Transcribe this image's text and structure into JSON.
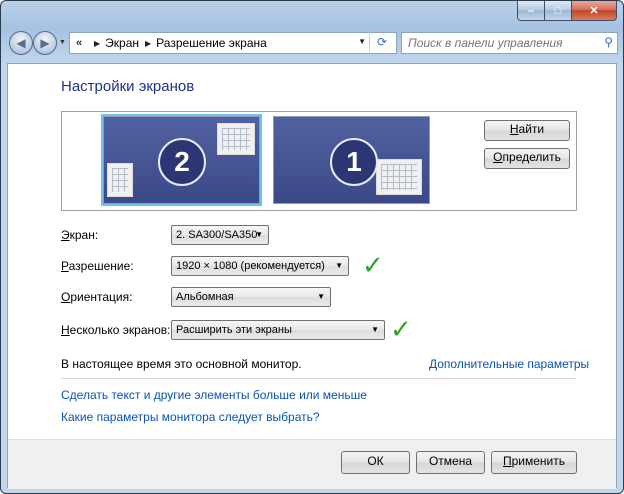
{
  "window": {
    "caption_buttons": {
      "minimize": "‒",
      "maximize": "□",
      "close": "✕"
    }
  },
  "nav": {
    "back_icon": "back-arrow-icon",
    "forward_icon": "forward-arrow-icon",
    "address_overflow": "«",
    "breadcrumb": [
      "Экран",
      "Разрешение экрана"
    ],
    "search_placeholder": "Поиск в панели управления"
  },
  "main": {
    "title": "Настройки экранов",
    "monitors": [
      {
        "number": "2",
        "selected": true
      },
      {
        "number": "1",
        "selected": false
      }
    ],
    "find_button": {
      "underlined": "Н",
      "rest": "айти"
    },
    "identify_button": {
      "underlined": "О",
      "rest": "пределить"
    },
    "fields": [
      {
        "label_underlined": "Э",
        "label_rest": "кран:",
        "value": "2. SA300/SA350",
        "checked": false
      },
      {
        "label_underlined": "Р",
        "label_rest": "азрешение:",
        "value": "1920 × 1080 (рекомендуется)",
        "checked": true
      },
      {
        "label_underlined": "О",
        "label_rest": "риентация:",
        "value": "Альбомная",
        "checked": false
      },
      {
        "label_underlined": "Н",
        "label_rest": "есколько экранов:",
        "value": "Расширить эти экраны",
        "checked": true
      }
    ],
    "status_text": "В настоящее время это основной монитор.",
    "advanced_link": "Дополнительные параметры",
    "link_text_size": "Сделать текст и другие элементы больше или меньше",
    "link_which_params": "Какие параметры монитора следует выбрать?",
    "checkmark": "✓"
  },
  "footer": {
    "ok": "ОК",
    "cancel": "Отмена",
    "apply_underlined": "П",
    "apply_rest": "рименить"
  },
  "colors": {
    "title": "#1e3287",
    "link": "#0a52b5",
    "monitor_fill": "#3b4989",
    "selected_outline": "#6cc3f1",
    "checkmark": "#2aa52a"
  }
}
